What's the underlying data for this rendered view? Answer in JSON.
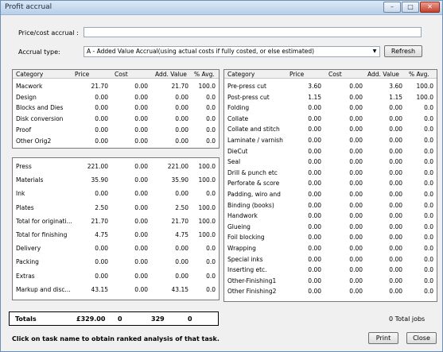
{
  "window": {
    "title": "Profit accrual"
  },
  "form": {
    "price_label": "Price/cost  accrual :",
    "price_value": "",
    "accrual_label": "Accrual type:",
    "accrual_value": "A - Added Value Accrual(using actual costs if fully costed, or else estimated)",
    "refresh_label": "Refresh"
  },
  "headers": {
    "category": "Category",
    "price": "Price",
    "cost": "Cost",
    "add_value": "Add. Value",
    "pct_avg": "% Avg."
  },
  "orig_rows": [
    [
      "Macwork",
      "21.70",
      "0.00",
      "21.70",
      "100.0"
    ],
    [
      "Design",
      "0.00",
      "0.00",
      "0.00",
      "0.0"
    ],
    [
      "Blocks and Dies",
      "0.00",
      "0.00",
      "0.00",
      "0.0"
    ],
    [
      "Disk conversion",
      "0.00",
      "0.00",
      "0.00",
      "0.0"
    ],
    [
      "Proof",
      "0.00",
      "0.00",
      "0.00",
      "0.0"
    ],
    [
      "Other Orig2",
      "0.00",
      "0.00",
      "0.00",
      "0.0"
    ]
  ],
  "summary_rows": [
    [
      "Press",
      "221.00",
      "0.00",
      "221.00",
      "100.0"
    ],
    [
      "Materials",
      "35.90",
      "0.00",
      "35.90",
      "100.0"
    ],
    [
      "Ink",
      "0.00",
      "0.00",
      "0.00",
      "0.0"
    ],
    [
      "Plates",
      "2.50",
      "0.00",
      "2.50",
      "100.0"
    ],
    [
      "Total for originati...",
      "21.70",
      "0.00",
      "21.70",
      "100.0"
    ],
    [
      "Total for finishing",
      "4.75",
      "0.00",
      "4.75",
      "100.0"
    ],
    [
      "Delivery",
      "0.00",
      "0.00",
      "0.00",
      "0.0"
    ],
    [
      "Packing",
      "0.00",
      "0.00",
      "0.00",
      "0.0"
    ],
    [
      "Extras",
      "0.00",
      "0.00",
      "0.00",
      "0.0"
    ],
    [
      "Markup and disc...",
      "43.15",
      "0.00",
      "43.15",
      "0.0"
    ]
  ],
  "finish_rows": [
    [
      "Pre-press cut",
      "3.60",
      "0.00",
      "3.60",
      "100.0"
    ],
    [
      "Post-press cut",
      "1.15",
      "0.00",
      "1.15",
      "100.0"
    ],
    [
      "Folding",
      "0.00",
      "0.00",
      "0.00",
      "0.0"
    ],
    [
      "Collate",
      "0.00",
      "0.00",
      "0.00",
      "0.0"
    ],
    [
      "Collate and stitch",
      "0.00",
      "0.00",
      "0.00",
      "0.0"
    ],
    [
      "Laminate / varnish...",
      "0.00",
      "0.00",
      "0.00",
      "0.0"
    ],
    [
      "DieCut",
      "0.00",
      "0.00",
      "0.00",
      "0.0"
    ],
    [
      "Seal",
      "0.00",
      "0.00",
      "0.00",
      "0.0"
    ],
    [
      "Drill & punch etc",
      "0.00",
      "0.00",
      "0.00",
      "0.0"
    ],
    [
      "Perforate & score",
      "0.00",
      "0.00",
      "0.00",
      "0.0"
    ],
    [
      "Padding, wiro and ...",
      "0.00",
      "0.00",
      "0.00",
      "0.0"
    ],
    [
      "Binding (books)",
      "0.00",
      "0.00",
      "0.00",
      "0.0"
    ],
    [
      "Handwork",
      "0.00",
      "0.00",
      "0.00",
      "0.0"
    ],
    [
      "Glueing",
      "0.00",
      "0.00",
      "0.00",
      "0.0"
    ],
    [
      "Foil blocking",
      "0.00",
      "0.00",
      "0.00",
      "0.0"
    ],
    [
      "Wrapping",
      "0.00",
      "0.00",
      "0.00",
      "0.0"
    ],
    [
      "Special inks",
      "0.00",
      "0.00",
      "0.00",
      "0.0"
    ],
    [
      "Inserting etc.",
      "0.00",
      "0.00",
      "0.00",
      "0.0"
    ],
    [
      "Other-Finishing1",
      "0.00",
      "0.00",
      "0.00",
      "0.0"
    ],
    [
      "Other Finishing2",
      "0.00",
      "0.00",
      "0.00",
      "0.0"
    ]
  ],
  "totals": {
    "label": "Totals",
    "price": "£329.00",
    "cost": "0",
    "add_value": "329",
    "pct": "0"
  },
  "footer": {
    "jobs": "0 Total jobs",
    "hint": "Click on task name to obtain ranked analysis of that task.",
    "print_label": "Print",
    "close_label": "Close"
  }
}
